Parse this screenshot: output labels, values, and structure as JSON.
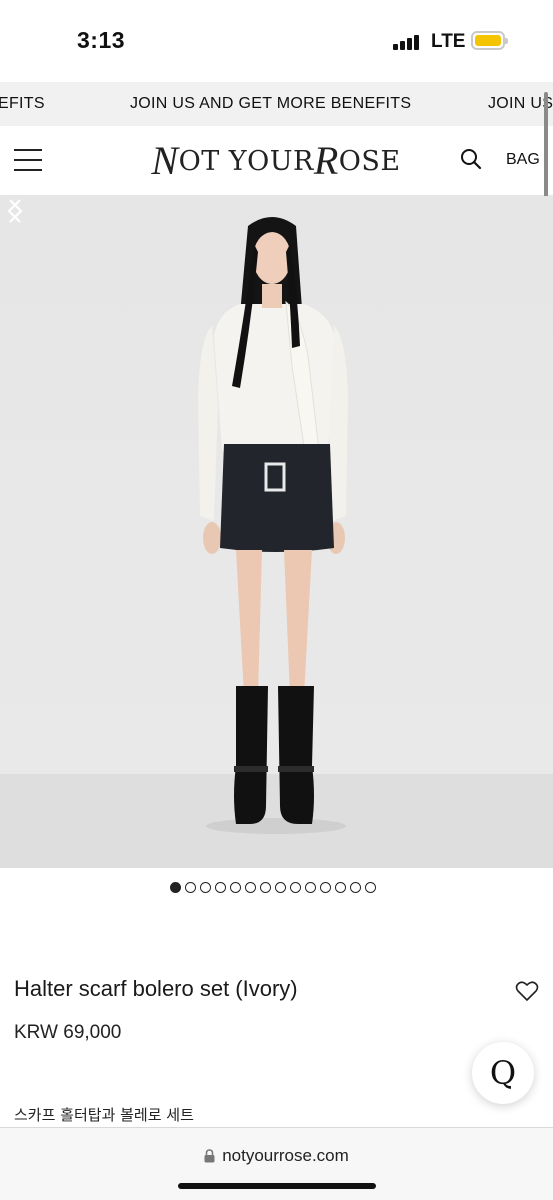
{
  "status_bar": {
    "time": "3:13",
    "network": "LTE",
    "battery_color": "#f5c400",
    "signal_bars": 4
  },
  "banner": {
    "items": [
      "EFITS",
      "JOIN US AND GET MORE BENEFITS",
      "JOIN US"
    ],
    "background": "#f1f1f1"
  },
  "header": {
    "menu_icon": "hamburger-menu-icon",
    "logo": {
      "script_n": "N",
      "part1": "OT YOUR ",
      "script_r": "R",
      "part2": "OSE"
    },
    "search_icon": "search-icon",
    "bag_label": "BAG"
  },
  "gallery": {
    "prev_icon": "chevron-left-icon",
    "next_icon": "chevron-right-icon",
    "total_images": 14,
    "active_index": 0
  },
  "product": {
    "title": "Halter scarf bolero set (Ivory)",
    "price": "KRW 69,000",
    "description": "스카프 홀터탑과 볼레로 세트",
    "wishlist_icon": "heart-outline-icon"
  },
  "chat_button": {
    "label": "Q"
  },
  "browser": {
    "url": "notyourrose.com",
    "lock_icon": "lock-icon"
  }
}
